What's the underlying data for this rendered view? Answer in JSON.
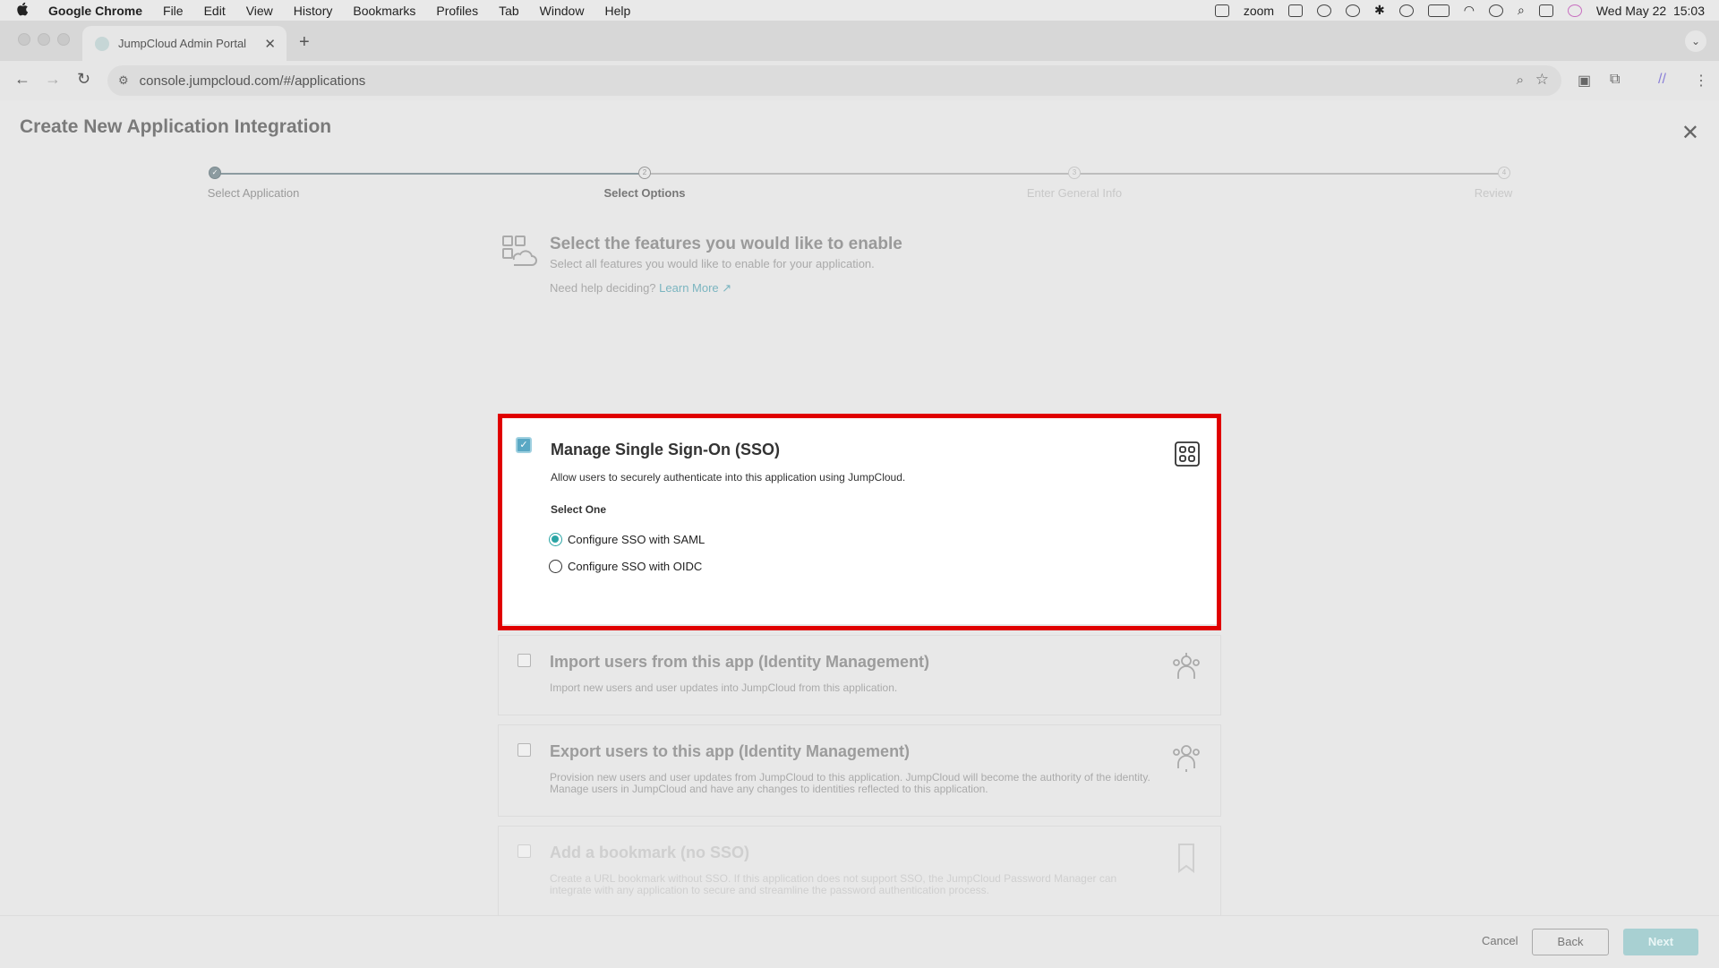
{
  "menubar": {
    "apple": "",
    "items": [
      "Google Chrome",
      "File",
      "Edit",
      "View",
      "History",
      "Bookmarks",
      "Profiles",
      "Tab",
      "Window",
      "Help"
    ],
    "zoom_label": "zoom",
    "datetime": "Wed May 22  15:03"
  },
  "browser": {
    "tab_title": "JumpCloud Admin Portal",
    "tab_close": "✕",
    "new_tab": "+",
    "url": "console.jumpcloud.com/#/applications"
  },
  "page": {
    "title": "Create New Application Integration",
    "close": "✕"
  },
  "stepper": {
    "steps": [
      {
        "label": "Select Application",
        "number": "1",
        "state": "done"
      },
      {
        "label": "Select Options",
        "number": "2",
        "state": "current"
      },
      {
        "label": "Enter General Info",
        "number": "3",
        "state": "future"
      },
      {
        "label": "Review",
        "number": "4",
        "state": "future"
      }
    ]
  },
  "features": {
    "title": "Select the features you would like to enable",
    "subtitle": "Select all features you would like to enable for your application.",
    "help_text": "Need help deciding?",
    "help_link": "Learn More ↗"
  },
  "sso_card": {
    "checked": true,
    "title": "Manage Single Sign-On (SSO)",
    "description": "Allow users to securely authenticate into this application using JumpCloud.",
    "select_label": "Select One",
    "options": [
      {
        "label": "Configure SSO with SAML",
        "selected": true
      },
      {
        "label": "Configure SSO with OIDC",
        "selected": false
      }
    ]
  },
  "import_card": {
    "title": "Import users from this app (Identity Management)",
    "description": "Import new users and user updates into JumpCloud from this application."
  },
  "export_card": {
    "title": "Export users to this app (Identity Management)",
    "description": "Provision new users and user updates from JumpCloud to this application. JumpCloud will become the authority of the identity. Manage users in JumpCloud and have any changes to identities reflected to this application."
  },
  "bookmark_card": {
    "title": "Add a bookmark (no SSO)",
    "description": "Create a URL bookmark without SSO. If this application does not support SSO, the JumpCloud Password Manager can integrate with any application to secure and streamline the password authentication process."
  },
  "footer": {
    "cancel": "Cancel",
    "back": "Back",
    "next": "Next"
  },
  "colors": {
    "highlight": "#e00000",
    "accent": "#2aa5a5",
    "next_disabled": "#a8d0d2"
  }
}
